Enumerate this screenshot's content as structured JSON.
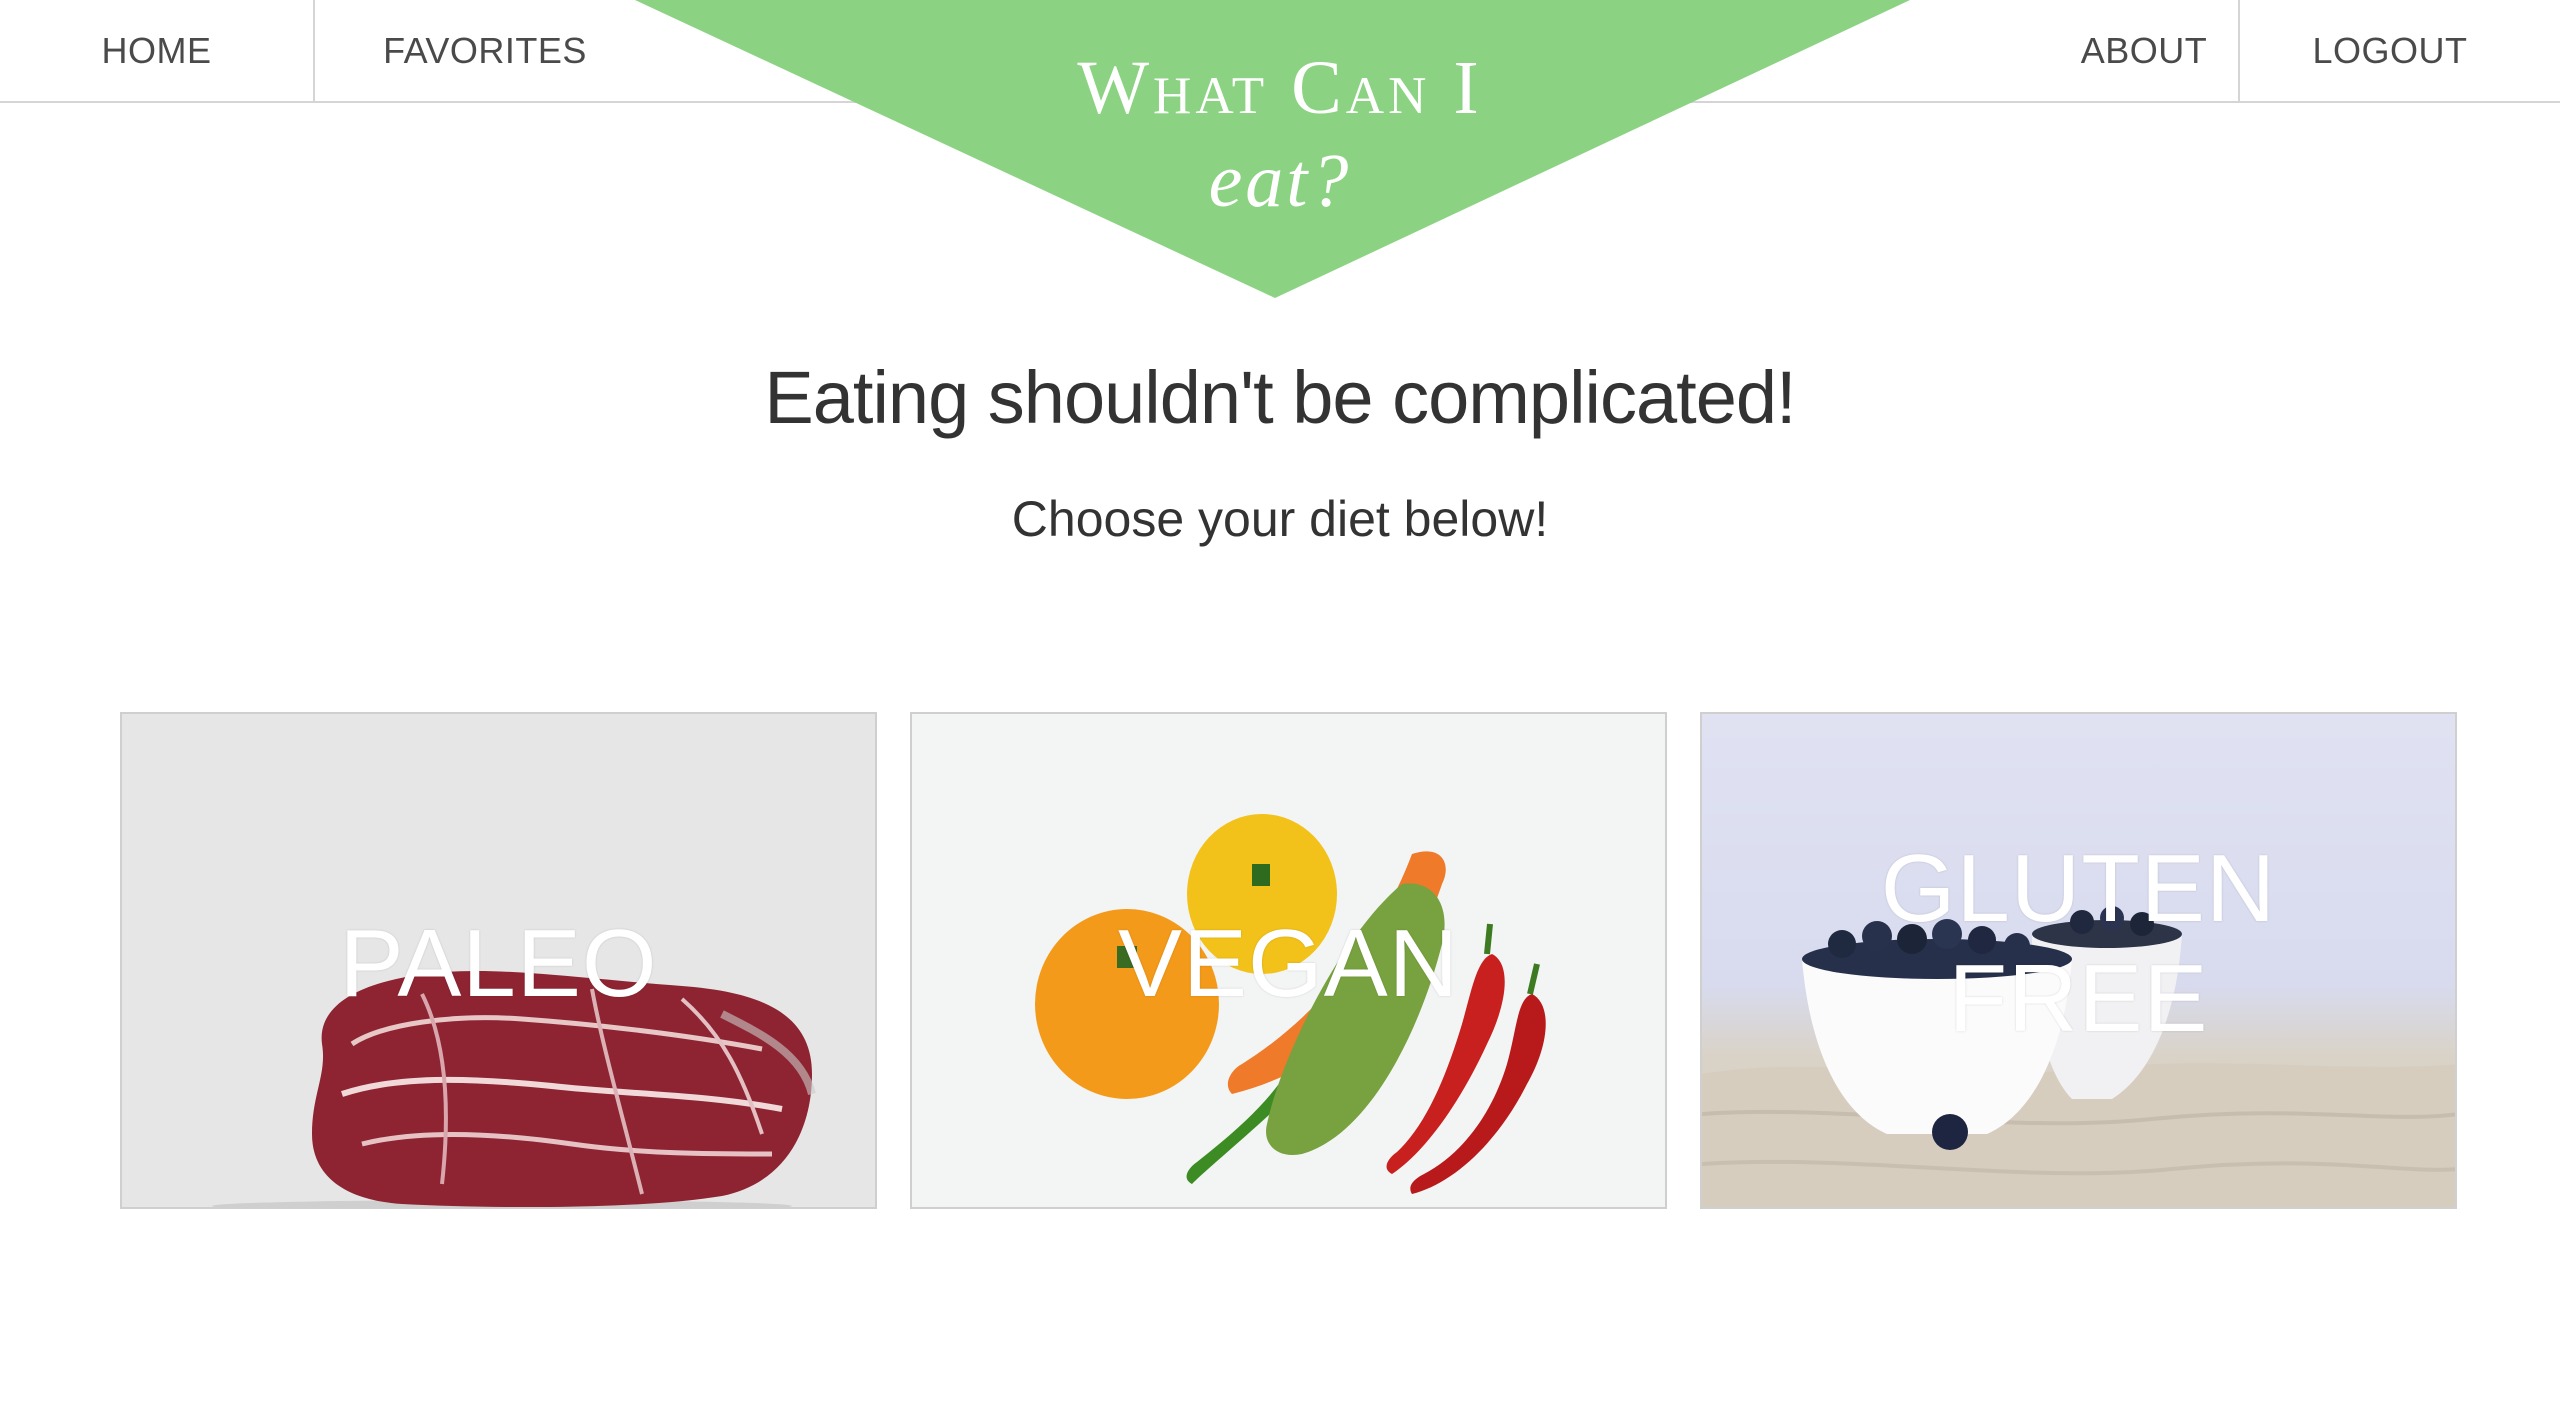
{
  "nav": {
    "home": "HOME",
    "favorites": "FAVORITES",
    "about": "ABOUT",
    "logout": "LOGOUT"
  },
  "logo": {
    "line1": "What Can I",
    "line2": "eat?",
    "color": "#8bd382"
  },
  "hero": {
    "headline": "Eating shouldn't be complicated!",
    "subheadline": "Choose your diet below!"
  },
  "diets": [
    {
      "label": "PALEO",
      "image": "raw-steak"
    },
    {
      "label": "VEGAN",
      "image": "peppers-and-vegetables"
    },
    {
      "label_line1": "GLUTEN",
      "label_line2": "FREE",
      "image": "blueberries-in-bowls"
    }
  ]
}
